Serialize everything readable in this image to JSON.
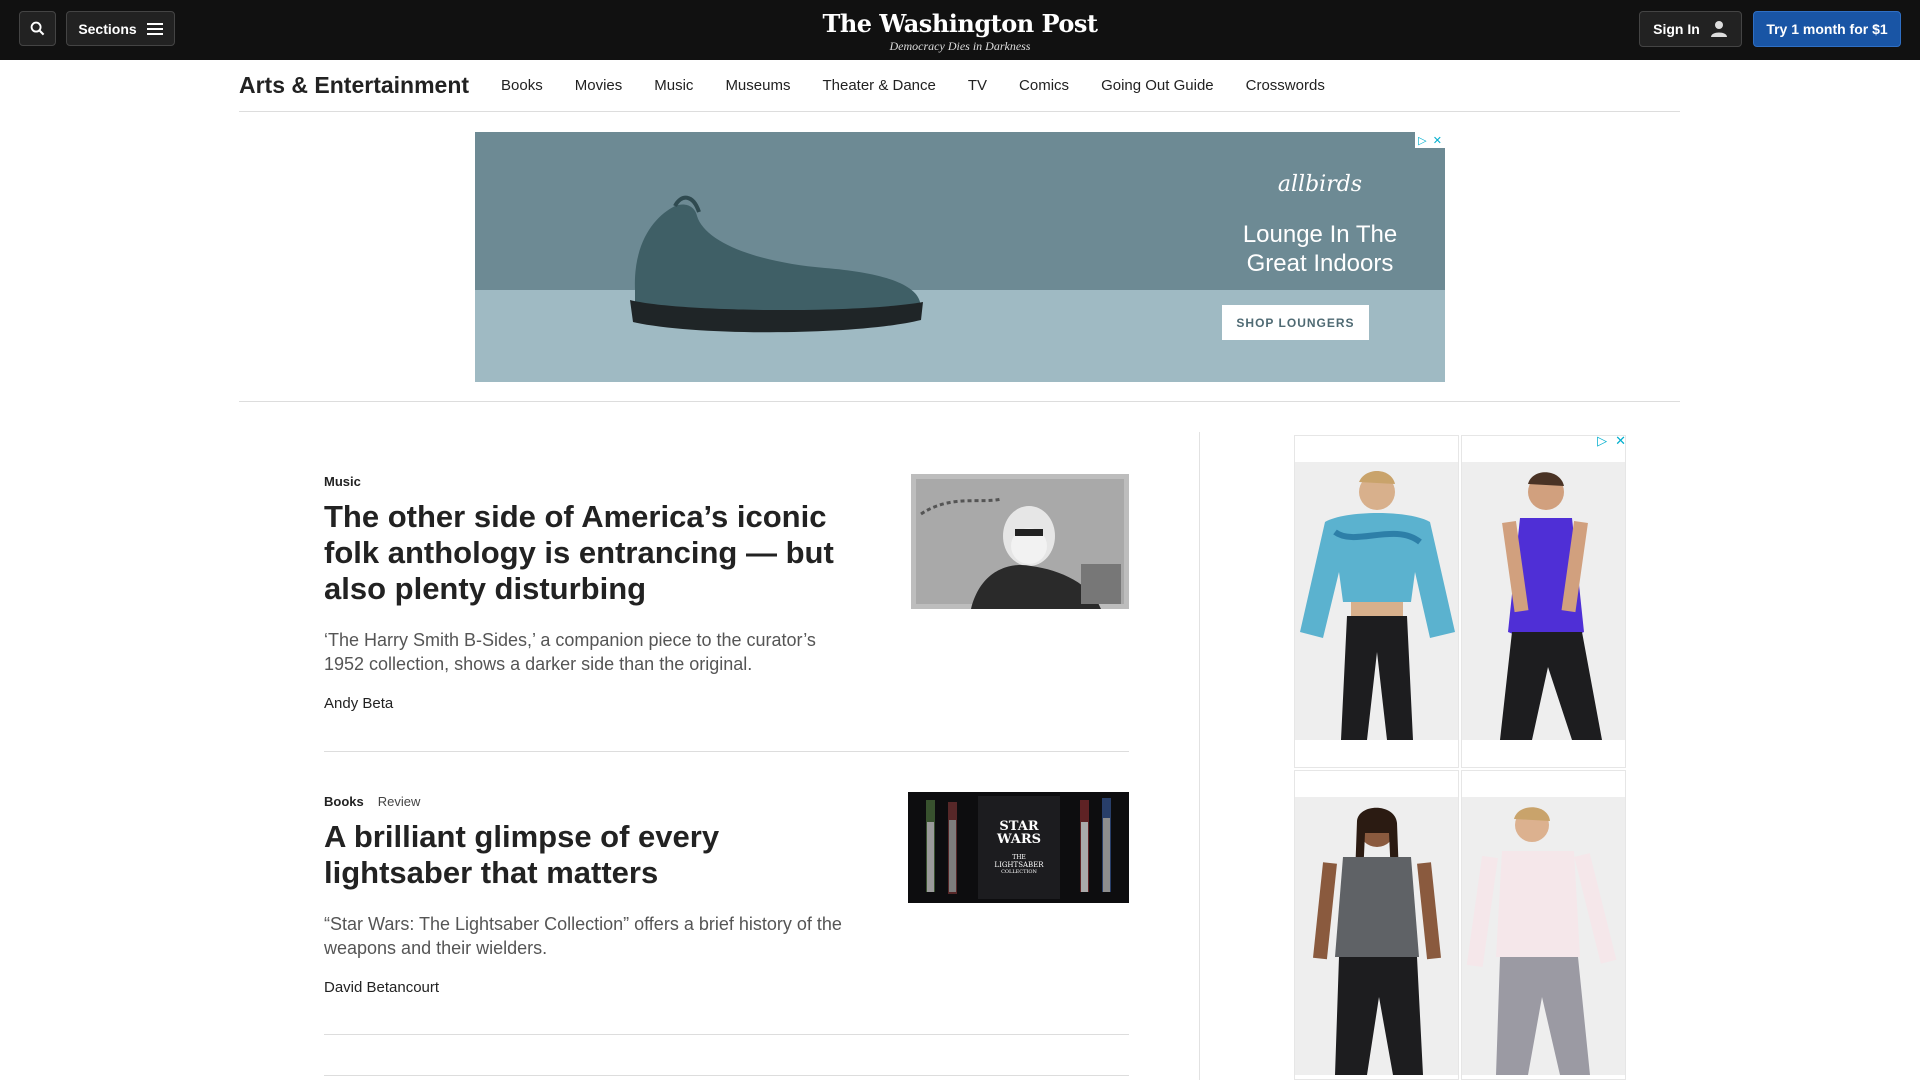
{
  "header": {
    "sections_label": "Sections",
    "logo": "The Washington Post",
    "tagline": "Democracy Dies in Darkness",
    "sign_in_label": "Sign In",
    "trial_label": "Try 1 month for $1"
  },
  "section_nav": {
    "title": "Arts & Entertainment",
    "links": [
      "Books",
      "Movies",
      "Music",
      "Museums",
      "Theater & Dance",
      "TV",
      "Comics",
      "Going Out Guide",
      "Crosswords"
    ]
  },
  "ad_banner": {
    "brand": "allbirds",
    "headline_line1": "Lounge In The",
    "headline_line2": "Great Indoors",
    "cta": "SHOP LOUNGERS"
  },
  "stories": [
    {
      "kicker": "Music",
      "label": "",
      "headline": "The other side of America’s iconic folk anthology is entrancing — but also plenty disturbing",
      "blurb": "‘The Harry Smith B-Sides,’ a companion piece to the curator’s 1952 collection, shows a darker side than the original.",
      "byline": "Andy Beta"
    },
    {
      "kicker": "Books",
      "label": "Review",
      "headline": "A brilliant glimpse of every lightsaber that matters",
      "blurb": "“Star Wars: The Lightsaber Collection” offers a brief history of the weapons and their wielders.",
      "byline": "David Betancourt"
    }
  ],
  "thumb2": {
    "line1": "STAR",
    "line2": "WARS",
    "line3": "THE",
    "line4": "LIGHTSABER",
    "line5": "COLLECTION"
  },
  "colors": {
    "topbar": "#111111",
    "trial_button": "#1955a5",
    "ad_background": "#6d8a94"
  }
}
